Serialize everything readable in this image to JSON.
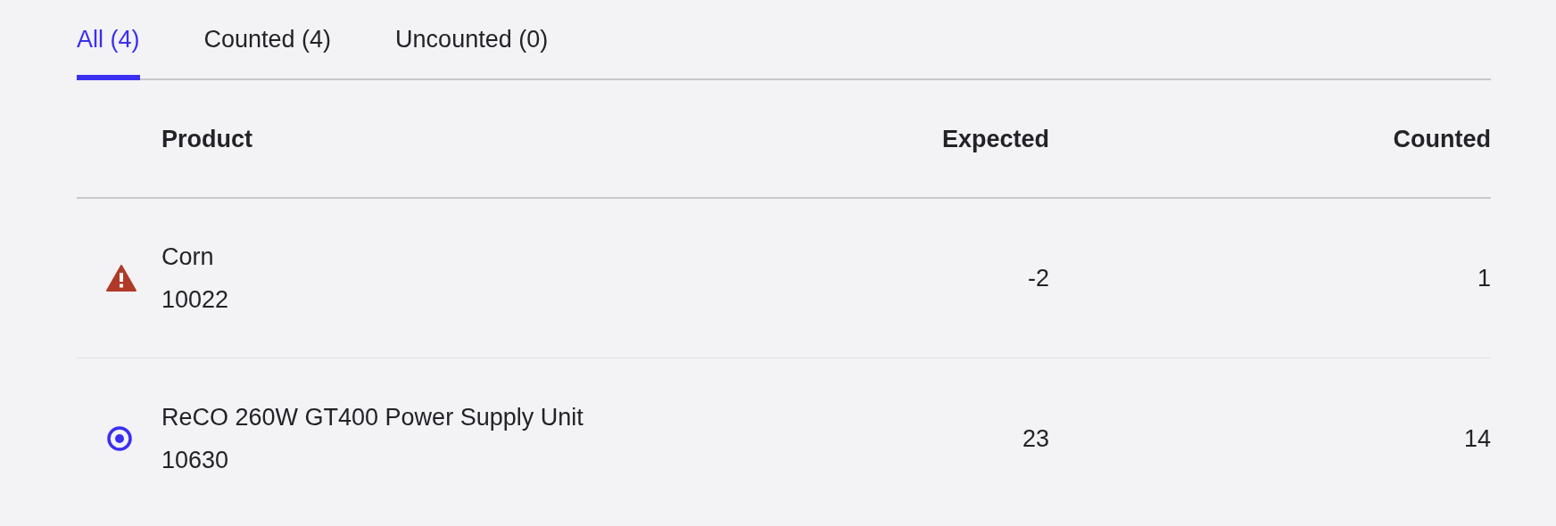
{
  "tabs": [
    {
      "label": "All (4)",
      "selected": true
    },
    {
      "label": "Counted (4)",
      "selected": false
    },
    {
      "label": "Uncounted (0)",
      "selected": false
    }
  ],
  "table": {
    "columns": [
      "Product",
      "Expected",
      "Counted"
    ],
    "rows": [
      {
        "kind": "warning",
        "product": "Corn",
        "code": "10022",
        "expected": "-2",
        "counted": "1"
      },
      {
        "kind": "target",
        "product": "ReCO 260W GT400 Power Supply Unit",
        "code": "10630",
        "expected": "23",
        "counted": "14"
      }
    ]
  }
}
